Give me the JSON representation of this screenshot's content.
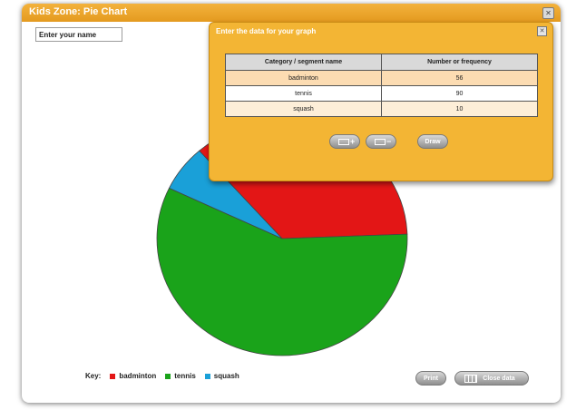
{
  "window": {
    "title": "Kids Zone: Pie Chart",
    "close_icon": "✕"
  },
  "name_input": {
    "placeholder": "Enter your name"
  },
  "dialog": {
    "title": "Enter the data for your graph",
    "close_icon": "✕",
    "columns": [
      "Category / segment name",
      "Number or frequency"
    ],
    "rows": [
      {
        "category": "badminton",
        "value": "56"
      },
      {
        "category": "tennis",
        "value": "90"
      },
      {
        "category": "squash",
        "value": "10"
      }
    ],
    "draw_label": "Draw"
  },
  "key": {
    "label": "Key:",
    "items": [
      {
        "name": "badminton",
        "color": "#e31616"
      },
      {
        "name": "tennis",
        "color": "#1aa31a"
      },
      {
        "name": "squash",
        "color": "#1aa0d8"
      }
    ]
  },
  "buttons": {
    "print": "Print",
    "close_data": "Close data"
  },
  "chart_data": {
    "type": "pie",
    "categories": [
      "badminton",
      "tennis",
      "squash"
    ],
    "values": [
      56,
      90,
      10
    ],
    "colors": [
      "#e31616",
      "#1aa31a",
      "#1aa0d8"
    ]
  }
}
